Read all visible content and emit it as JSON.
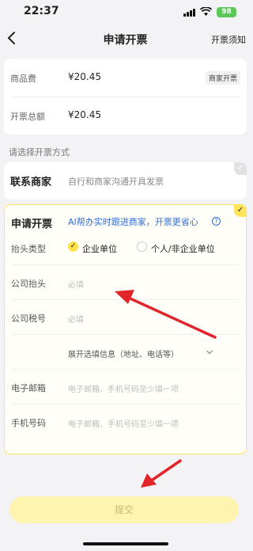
{
  "status_bar": {
    "time": "22:37",
    "battery": "98"
  },
  "nav": {
    "title": "申请开票",
    "right_link": "开票须知"
  },
  "fees": [
    {
      "label": "商品费",
      "value": "¥20.45",
      "tag": "商家开票"
    },
    {
      "label": "开票总额",
      "value": "¥20.45"
    }
  ],
  "section_title": "请选择开票方式",
  "merchant_option": {
    "title": "联系商家",
    "desc": "自行和商家沟通开具发票"
  },
  "invoice_option": {
    "title": "申请开票",
    "desc": "AI帮办实时跟进商家，开票更省心",
    "header_type": {
      "label": "抬头类型",
      "options": [
        "企业单位",
        "个人/非企业单位"
      ],
      "selected": "企业单位"
    },
    "company_title": {
      "label": "公司抬头",
      "placeholder": "必填"
    },
    "tax_id": {
      "label": "公司税号",
      "placeholder": "必填"
    },
    "expand_text": "展开选填信息（地址、电话等）",
    "email": {
      "label": "电子邮箱",
      "placeholder": "电子邮箱、手机号码至少填一项"
    },
    "phone": {
      "label": "手机号码",
      "placeholder": "电子邮箱、手机号码至少填一项"
    }
  },
  "submit_label": "提交",
  "colors": {
    "accent": "#ffe14a",
    "link": "#2f6fd8",
    "arrow": "#e0262a"
  },
  "icons": [
    "back-arrow-icon",
    "question-circle-icon",
    "check-icon",
    "chevron-down-icon"
  ]
}
